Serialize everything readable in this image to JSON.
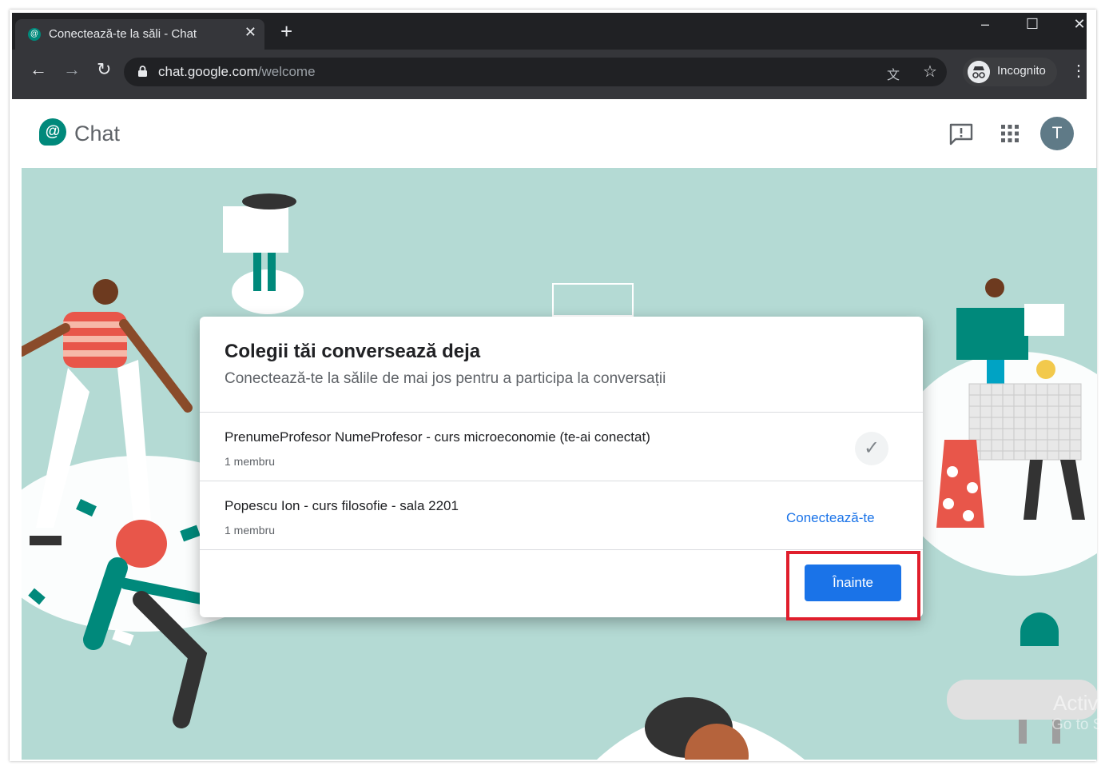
{
  "browser": {
    "tab_title": "Conectează-te la săli - Chat",
    "new_tab_symbol": "+",
    "url_host": "chat.google.com",
    "url_path": "/welcome",
    "incognito_label": "Incognito",
    "window_controls": [
      "–",
      "☐",
      "✕"
    ]
  },
  "app": {
    "name": "Chat",
    "avatar_initial": "T"
  },
  "dialog": {
    "title": "Colegii tăi conversează deja",
    "subtitle": "Conectează-te la sălile de mai jos pentru a participa la conversații",
    "rooms": [
      {
        "name": "PrenumeProfesor NumeProfesor - curs microeconomie (te-ai conectat)",
        "members": "1 membru",
        "status": "joined"
      },
      {
        "name": "Popescu Ion - curs filosofie - sala 2201",
        "members": "1 membru",
        "action": "Conectează-te"
      }
    ],
    "next_button": "Înainte"
  },
  "watermark": {
    "line1": "Activ",
    "line2": "Go to S"
  },
  "colors": {
    "accent": "#1a73e8",
    "highlight": "#e01e2c",
    "background": "#b4dad4",
    "brand": "#00897b"
  }
}
